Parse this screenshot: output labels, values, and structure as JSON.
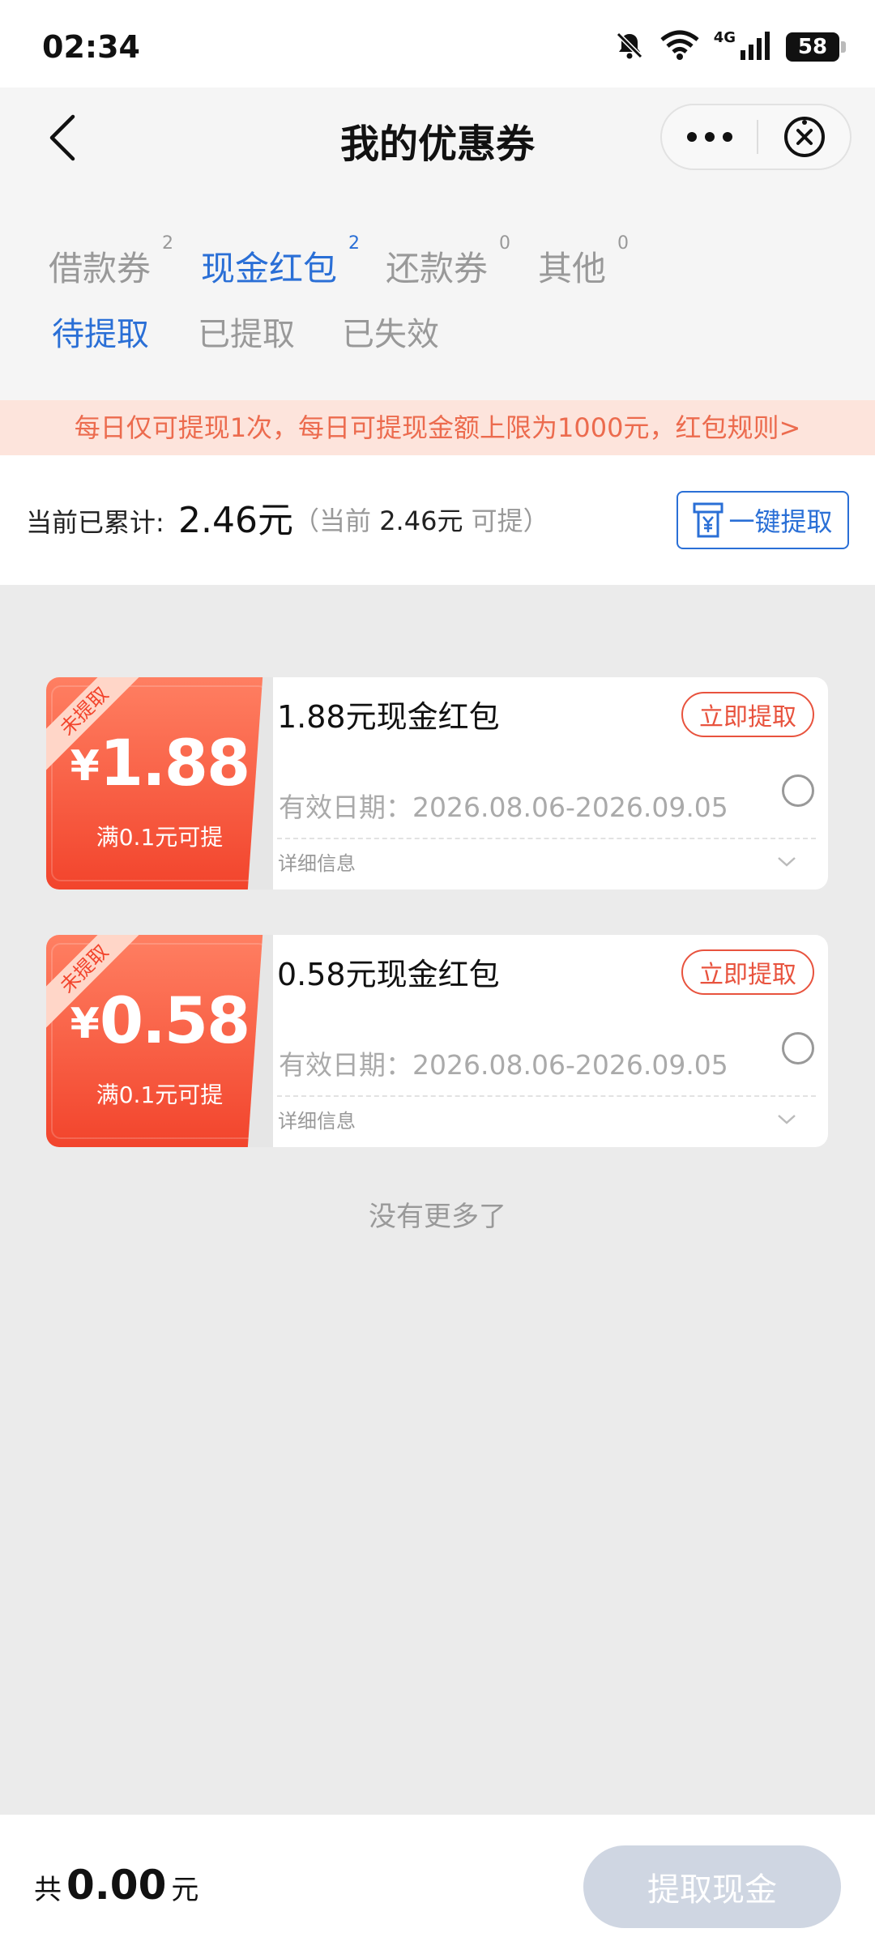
{
  "status_bar": {
    "time": "02:34",
    "network": "4G",
    "battery": "58"
  },
  "header": {
    "title": "我的优惠券",
    "more_icon": "more-dots-icon",
    "close_icon": "close-circle-icon",
    "back_icon": "chevron-left-icon"
  },
  "tabs": [
    {
      "label": "借款券",
      "count": "2",
      "active": false
    },
    {
      "label": "现金红包",
      "count": "2",
      "active": true
    },
    {
      "label": "还款券",
      "count": "0",
      "active": false
    },
    {
      "label": "其他",
      "count": "0",
      "active": false
    }
  ],
  "subtabs": [
    {
      "label": "待提取",
      "active": true
    },
    {
      "label": "已提取",
      "active": false
    },
    {
      "label": "已失效",
      "active": false
    }
  ],
  "notice": "每日仅可提现1次，每日可提现金额上限为1000元，红包规则>",
  "summary": {
    "label": "当前已累计:",
    "value": "2.46元",
    "note_prefix": "（当前",
    "note_value": "2.46元",
    "note_suffix": "可提）",
    "withdraw_all_label": "一键提取"
  },
  "coupons": [
    {
      "ribbon": "未提取",
      "currency": "¥",
      "amount": "1.88",
      "condition": "满0.1元可提",
      "title": "1.88元现金红包",
      "claim_label": "立即提取",
      "validity": "有效日期：2026.08.06-2026.09.05",
      "detail": "详细信息"
    },
    {
      "ribbon": "未提取",
      "currency": "¥",
      "amount": "0.58",
      "condition": "满0.1元可提",
      "title": "0.58元现金红包",
      "claim_label": "立即提取",
      "validity": "有效日期：2026.08.06-2026.09.05",
      "detail": "详细信息"
    }
  ],
  "end_text": "没有更多了",
  "footer": {
    "total_prefix": "共",
    "total_value": "0.00",
    "total_unit": "元",
    "cash_button": "提取现金"
  },
  "colors": {
    "accent_blue": "#2a6fd6",
    "coupon_red": "#f2442c",
    "notice_bg": "#fde4dc",
    "disabled_button": "#cfd6e2"
  }
}
